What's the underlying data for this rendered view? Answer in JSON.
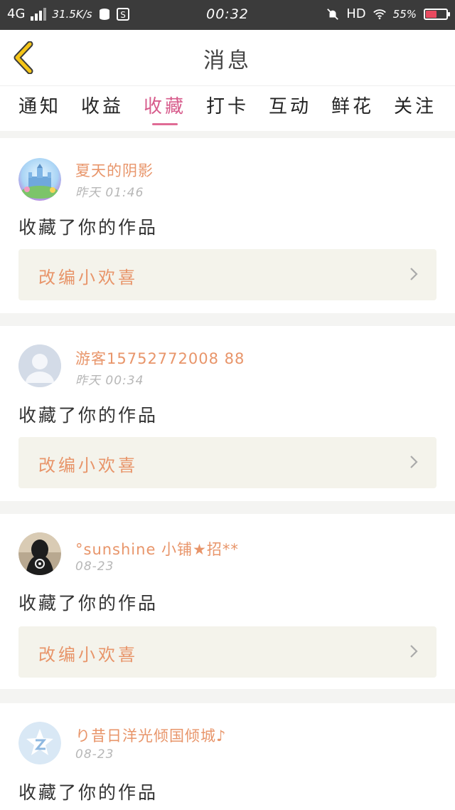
{
  "status_bar": {
    "network": "4G",
    "speed": "31.5K/s",
    "time": "00:32",
    "hd": "HD",
    "battery": "55%",
    "battery_level": 0.55,
    "battery_color": "#e84a5f"
  },
  "header": {
    "title": "消息",
    "back_icon": "chevron-left-icon",
    "accent_color": "#f5c518"
  },
  "tabs": [
    {
      "label": "通知"
    },
    {
      "label": "收益"
    },
    {
      "label": "收藏",
      "active": true
    },
    {
      "label": "打卡"
    },
    {
      "label": "互动"
    },
    {
      "label": "鲜花"
    },
    {
      "label": "关注"
    }
  ],
  "messages": [
    {
      "user": "夏天的阴影",
      "time": "昨天 01:46",
      "text": "收藏了你的作品",
      "work": "改编小欢喜",
      "avatar": "castle-avatar"
    },
    {
      "user": "游客15752772008 88",
      "time": "昨天 00:34",
      "text": "收藏了你的作品",
      "work": "改编小欢喜",
      "avatar": "default-user-avatar"
    },
    {
      "user": "°sunshine 小铺★招**",
      "time": "08-23",
      "text": "收藏了你的作品",
      "work": "改编小欢喜",
      "avatar": "girl-photo-avatar"
    },
    {
      "user": "り昔日洋光倾国倾城♪",
      "time": "08-23",
      "text": "收藏了你的作品",
      "work": "",
      "avatar": "qzone-avatar"
    }
  ]
}
